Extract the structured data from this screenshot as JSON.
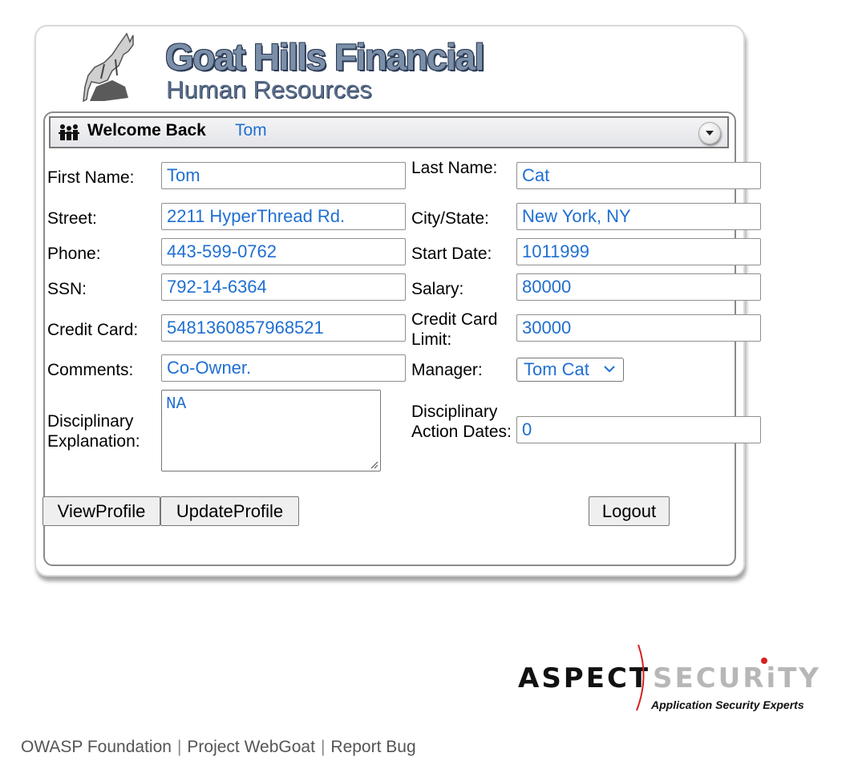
{
  "header": {
    "title": "Goat Hills Financial",
    "subtitle": "Human Resources",
    "logo_icon": "goat-logo-icon"
  },
  "welcome": {
    "prefix": "Welcome Back",
    "user": "Tom",
    "icon": "people-icon",
    "toggle_icon": "dropdown-circle-icon"
  },
  "labels": {
    "first_name": "First Name:",
    "last_name": "Last Name:",
    "street": "Street:",
    "city_state": "City/State:",
    "phone": "Phone:",
    "start_date": "Start Date:",
    "ssn": "SSN:",
    "salary": "Salary:",
    "credit_card": "Credit Card:",
    "credit_card_limit": "Credit Card Limit:",
    "comments": "Comments:",
    "manager": "Manager:",
    "disciplinary_explanation": "Disciplinary Explanation:",
    "disciplinary_action_dates": "Disciplinary Action Dates:"
  },
  "values": {
    "first_name": "Tom",
    "last_name": "Cat",
    "street": "2211 HyperThread Rd.",
    "city_state": "New York, NY",
    "phone": "443-599-0762",
    "start_date": "1011999",
    "ssn": "792-14-6364",
    "salary": "80000",
    "credit_card": "5481360857968521",
    "credit_card_limit": "30000",
    "comments": "Co-Owner.",
    "manager": "Tom Cat",
    "disciplinary_explanation": "NA",
    "disciplinary_action_dates": "0"
  },
  "buttons": {
    "view_profile": "ViewProfile",
    "update_profile": "UpdateProfile",
    "logout": "Logout"
  },
  "sponsor": {
    "word1": "ASPECT",
    "word2": "SECURiTY",
    "tagline": "Application Security Experts"
  },
  "footer": {
    "links": [
      "OWASP Foundation",
      "Project WebGoat",
      "Report Bug"
    ],
    "separator": "|"
  },
  "colors": {
    "value_text": "#1f6fd1",
    "title": "#7b8fa8",
    "accent_red": "#d52222"
  }
}
